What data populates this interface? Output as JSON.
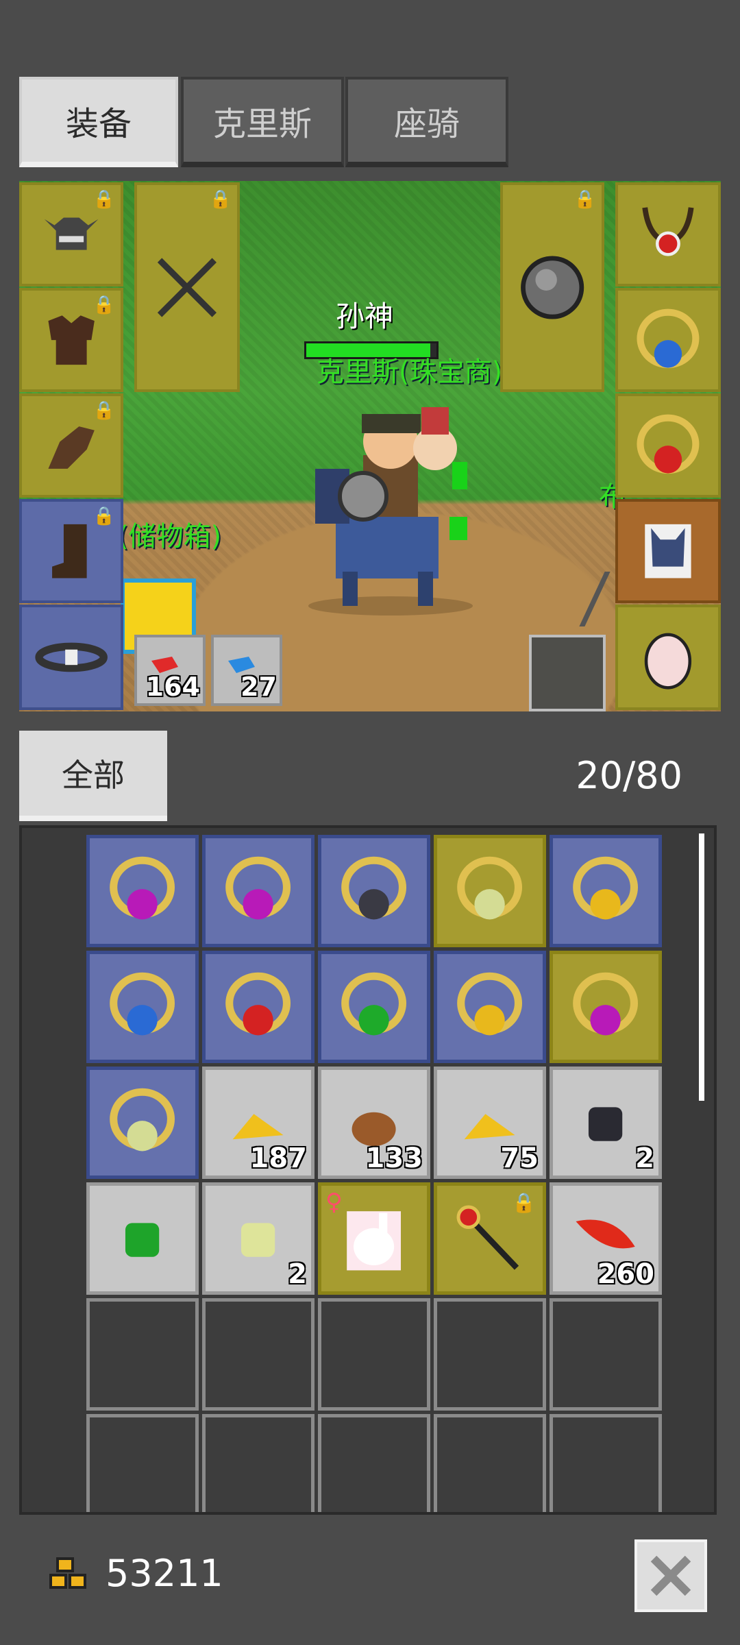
{
  "tabs": [
    {
      "label": "装备",
      "active": true
    },
    {
      "label": "克里斯",
      "active": false
    },
    {
      "label": "座骑",
      "active": false
    }
  ],
  "scene": {
    "player_name": "孙神",
    "hp_fraction": 0.95,
    "npc_jeweler": "克里斯(珠宝商)",
    "npc_storage": "(储物箱)",
    "npc_right_partial": "布",
    "potions": [
      {
        "icon": "red-potion-icon",
        "count": "164"
      },
      {
        "icon": "blue-potion-icon",
        "count": "27"
      }
    ]
  },
  "equip_slots": [
    {
      "icon": "horned-helmet-icon",
      "locked": true
    },
    {
      "icon": "armor-icon",
      "locked": true
    },
    {
      "icon": "gloves-icon",
      "locked": true
    },
    {
      "icon": "boots-icon",
      "locked": true
    },
    {
      "icon": "belt-icon",
      "locked": false
    },
    {
      "icon": "crossed-swords-icon",
      "locked": true
    },
    {
      "icon": "round-shield-icon",
      "locked": true
    },
    {
      "icon": "ruby-necklace-icon",
      "locked": false
    },
    {
      "icon": "sapphire-ring-icon",
      "locked": false
    },
    {
      "icon": "ruby-ring-icon",
      "locked": false
    },
    {
      "icon": "mount-portrait-icon",
      "locked": false
    },
    {
      "icon": "pet-egg-icon",
      "locked": false
    }
  ],
  "filter": {
    "label": "全部"
  },
  "capacity": "20/80",
  "inventory": [
    {
      "icon": "amethyst-ring-icon",
      "rarity": "blue",
      "count": ""
    },
    {
      "icon": "amethyst-ring-icon",
      "rarity": "blue",
      "count": ""
    },
    {
      "icon": "onyx-ring-icon",
      "rarity": "blue",
      "count": ""
    },
    {
      "icon": "jade-ring-icon",
      "rarity": "gold",
      "count": ""
    },
    {
      "icon": "topaz-ring-icon",
      "rarity": "blue",
      "count": ""
    },
    {
      "icon": "sapphire-ring-icon",
      "rarity": "blue",
      "count": ""
    },
    {
      "icon": "ruby-ring-icon",
      "rarity": "blue",
      "count": ""
    },
    {
      "icon": "emerald-ring-icon",
      "rarity": "blue",
      "count": ""
    },
    {
      "icon": "topaz-ring-icon",
      "rarity": "blue",
      "count": ""
    },
    {
      "icon": "amethyst-ring-icon",
      "rarity": "gold",
      "count": ""
    },
    {
      "icon": "jade-ring-icon",
      "rarity": "blue",
      "count": ""
    },
    {
      "icon": "gold-ore-icon",
      "rarity": "gray",
      "count": "187"
    },
    {
      "icon": "copper-ore-icon",
      "rarity": "gray",
      "count": "133"
    },
    {
      "icon": "gold-ore-icon",
      "rarity": "gray",
      "count": "75"
    },
    {
      "icon": "black-gem-icon",
      "rarity": "gray",
      "count": "2"
    },
    {
      "icon": "green-gem-icon",
      "rarity": "gray",
      "count": ""
    },
    {
      "icon": "pale-gem-icon",
      "rarity": "gray",
      "count": "2"
    },
    {
      "icon": "rabbit-pet-icon",
      "rarity": "gold",
      "count": "",
      "gender": "♀"
    },
    {
      "icon": "ruby-staff-icon",
      "rarity": "gold",
      "count": "",
      "locked": true
    },
    {
      "icon": "red-feather-icon",
      "rarity": "gray",
      "count": "260"
    },
    {
      "icon": "",
      "rarity": "empty",
      "count": ""
    },
    {
      "icon": "",
      "rarity": "empty",
      "count": ""
    },
    {
      "icon": "",
      "rarity": "empty",
      "count": ""
    },
    {
      "icon": "",
      "rarity": "empty",
      "count": ""
    },
    {
      "icon": "",
      "rarity": "empty",
      "count": ""
    },
    {
      "icon": "",
      "rarity": "empty",
      "count": ""
    },
    {
      "icon": "",
      "rarity": "empty",
      "count": ""
    },
    {
      "icon": "",
      "rarity": "empty",
      "count": ""
    },
    {
      "icon": "",
      "rarity": "empty",
      "count": ""
    },
    {
      "icon": "",
      "rarity": "empty",
      "count": ""
    }
  ],
  "footer": {
    "gold_amount": "53211",
    "gold_icon": "gold-coins-icon",
    "close_icon": "close-icon"
  },
  "colors": {
    "background": "#4b4b4b",
    "rarity_blue": "#6571ad",
    "rarity_gold": "#a69c30",
    "rarity_gray": "#c7c7c7",
    "name_green": "#34e024"
  }
}
